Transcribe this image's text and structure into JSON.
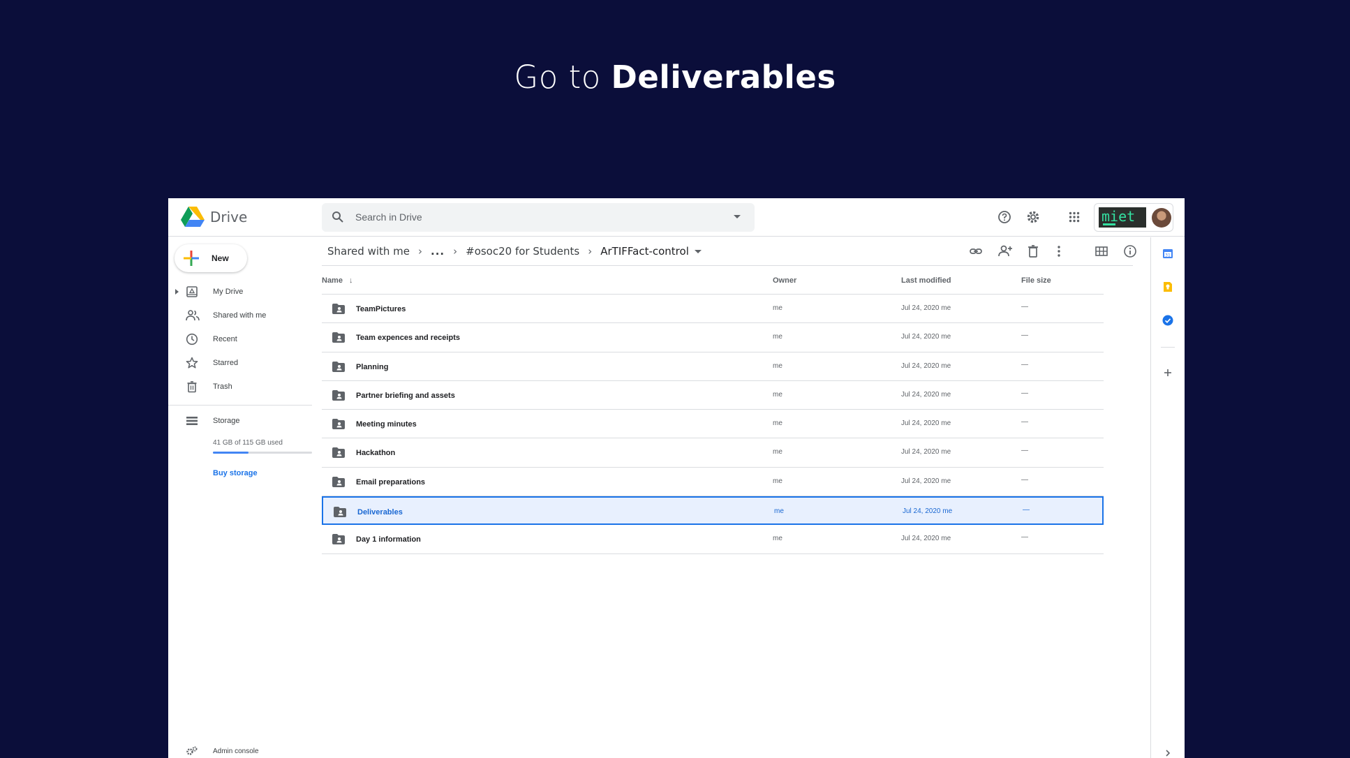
{
  "headline": {
    "prefix": "Go to ",
    "emphasis": "Deliverables"
  },
  "app": {
    "name": "Drive"
  },
  "search": {
    "placeholder": "Search in Drive"
  },
  "account": {
    "badge_text": "miet"
  },
  "sidebar": {
    "new_label": "New",
    "items": [
      {
        "label": "My Drive",
        "icon": "my-drive-icon"
      },
      {
        "label": "Shared with me",
        "icon": "people-icon"
      },
      {
        "label": "Recent",
        "icon": "clock-icon"
      },
      {
        "label": "Starred",
        "icon": "star-icon"
      },
      {
        "label": "Trash",
        "icon": "trash-icon"
      }
    ],
    "storage": {
      "label": "Storage",
      "used_text": "41 GB of 115 GB used",
      "used_fraction": 0.357
    },
    "buy_storage": "Buy storage",
    "admin_console": "Admin console"
  },
  "breadcrumb": {
    "items": [
      "Shared with me",
      "...",
      "#osoc20 for Students",
      "ArTIFFact-control"
    ]
  },
  "list": {
    "columns": {
      "name": "Name",
      "owner": "Owner",
      "modified": "Last modified",
      "size": "File size"
    },
    "rows": [
      {
        "name": "TeamPictures",
        "owner": "me",
        "modified": "Jul 24, 2020 me",
        "size": "—",
        "selected": false
      },
      {
        "name": "Team expences and receipts",
        "owner": "me",
        "modified": "Jul 24, 2020 me",
        "size": "—",
        "selected": false
      },
      {
        "name": "Planning",
        "owner": "me",
        "modified": "Jul 24, 2020 me",
        "size": "—",
        "selected": false
      },
      {
        "name": "Partner briefing and assets",
        "owner": "me",
        "modified": "Jul 24, 2020 me",
        "size": "—",
        "selected": false
      },
      {
        "name": "Meeting minutes",
        "owner": "me",
        "modified": "Jul 24, 2020 me",
        "size": "—",
        "selected": false
      },
      {
        "name": "Hackathon",
        "owner": "me",
        "modified": "Jul 24, 2020 me",
        "size": "—",
        "selected": false
      },
      {
        "name": "Email preparations",
        "owner": "me",
        "modified": "Jul 24, 2020 me",
        "size": "—",
        "selected": false
      },
      {
        "name": "Deliverables",
        "owner": "me",
        "modified": "Jul 24, 2020 me",
        "size": "—",
        "selected": true
      },
      {
        "name": "Day 1 information",
        "owner": "me",
        "modified": "Jul 24, 2020 me",
        "size": "—",
        "selected": false
      }
    ]
  },
  "colors": {
    "accent": "#1a73e8",
    "selected_bg": "#e8f0fe",
    "background": "#0b0e3a"
  }
}
